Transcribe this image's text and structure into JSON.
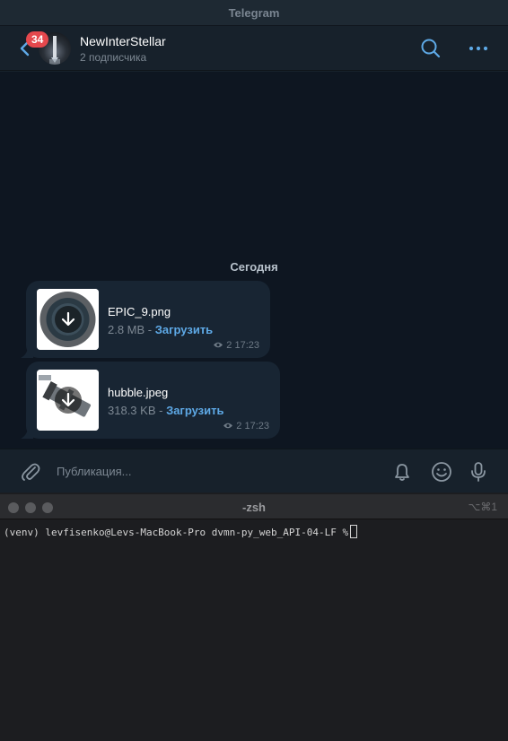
{
  "telegram": {
    "window_title": "Telegram",
    "unread_count": "34",
    "channel_name": "NewInterStellar",
    "channel_subtitle": "2 подписчика",
    "date_separator": "Сегодня",
    "messages": [
      {
        "file_name": "EPIC_9.png",
        "file_size": "2.8 MB",
        "separator": " - ",
        "download_label": "Загрузить",
        "views": "2",
        "time": "17:23"
      },
      {
        "file_name": "hubble.jpeg",
        "file_size": "318.3 KB",
        "separator": " - ",
        "download_label": "Загрузить",
        "views": "2",
        "time": "17:23"
      }
    ],
    "composer_placeholder": "Публикация...",
    "accent_color": "#5ea9e6",
    "badge_color": "#e5484d"
  },
  "terminal": {
    "window_title": "-zsh",
    "shortcut": "⌥⌘1",
    "prompt_text": "(venv) levfisenko@Levs-MacBook-Pro dvmn-py_web_API-04-LF %"
  }
}
